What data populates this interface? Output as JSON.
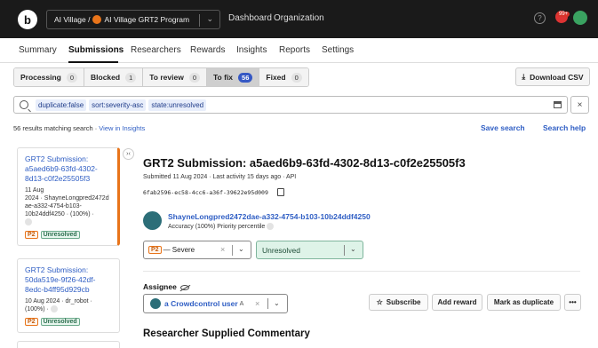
{
  "topbar": {
    "logo_letter": "b",
    "org_prefix": "AI Village /",
    "org_program": "AI Village GRT2 Program",
    "nav": [
      "Dashboard",
      "Organization"
    ],
    "help": "?",
    "notif_count": "99+"
  },
  "tabs": [
    "Summary",
    "Submissions",
    "Researchers",
    "Rewards",
    "Insights",
    "Reports",
    "Settings"
  ],
  "filters": [
    {
      "label": "Processing",
      "count": "0"
    },
    {
      "label": "Blocked",
      "count": "1"
    },
    {
      "label": "To review",
      "count": "0"
    },
    {
      "label": "To fix",
      "count": "56"
    },
    {
      "label": "Fixed",
      "count": "0"
    }
  ],
  "download_label": "Download CSV",
  "search": {
    "chips": [
      "duplicate:false",
      "sort:severity-asc",
      "state:unresolved"
    ]
  },
  "results": {
    "text": "56 results matching search · ",
    "link": "View in Insights"
  },
  "save_search": "Save search",
  "search_help": "Search help",
  "list": [
    {
      "title": "GRT2 Submission: a5aed6b9-63fd-4302-8d13-c0f2e25505f3",
      "meta1": "11 Aug",
      "meta2": "2024 · ShayneLongpred2472d",
      "meta3": "ae-a332-4754-b103-",
      "meta4": "10b24ddf4250 · (100%) ·",
      "priority": "P2",
      "status": "Unresolved"
    },
    {
      "title": "GRT2 Submission: 50da519e-9f26-42df-8edc-b4ff95d929cb",
      "meta1": "10 Aug 2024 · dr_robot ·",
      "meta2": "(100%) ·",
      "priority": "P2",
      "status": "Unresolved"
    }
  ],
  "detail": {
    "title": "GRT2 Submission: a5aed6b9-63fd-4302-8d13-c0f2e25505f3",
    "subtitle": "Submitted 11 Aug 2024 · Last activity 15 days ago · API",
    "hash": "6fab2596-ec58-4cc6-a36f-39622e95d009",
    "researcher": "ShayneLongpred2472dae-a332-4754-b103-10b24ddf4250",
    "accuracy": "Accuracy (100%)   Priority percentile",
    "severity_priority": "P2",
    "severity_label": "— Severe",
    "status": "Unresolved",
    "assignee_label": "Assignee",
    "assignee": "a Crowdcontrol user",
    "assignee_suffix": "A",
    "buttons": {
      "subscribe": "Subscribe",
      "add_reward": "Add reward",
      "mark_duplicate": "Mark as duplicate",
      "more": "•••"
    },
    "section": "Researcher Supplied Commentary"
  }
}
